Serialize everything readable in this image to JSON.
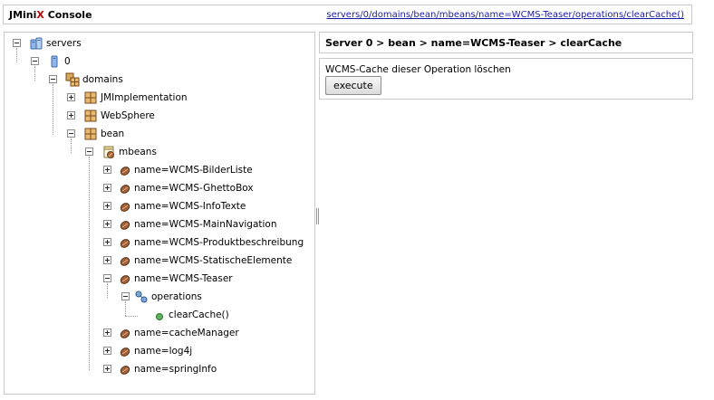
{
  "header": {
    "title_prefix": "JMini",
    "title_accent": "X",
    "title_suffix": " Console",
    "link": "servers/0/domains/bean/mbeans/name=WCMS-Teaser/operations/clearCache()"
  },
  "breadcrumb": "Server 0 > bean > name=WCMS-Teaser > clearCache",
  "operation": {
    "description": "WCMS-Cache dieser Operation löschen",
    "execute_label": "execute"
  },
  "tree": {
    "servers": "servers",
    "server0": "0",
    "domains": "domains",
    "domain_items": [
      "JMImplementation",
      "WebSphere",
      "bean"
    ],
    "mbeans": "mbeans",
    "mbean_items": [
      "name=WCMS-BilderListe",
      "name=WCMS-GhettoBox",
      "name=WCMS-InfoTexte",
      "name=WCMS-MainNavigation",
      "name=WCMS-Produktbeschreibung",
      "name=WCMS-StatischeElemente",
      "name=WCMS-Teaser",
      "name=cacheManager",
      "name=log4j",
      "name=springInfo"
    ],
    "operations": "operations",
    "clear_cache": "clearCache()"
  },
  "colors": {
    "accent": "#cc0000",
    "link": "#1a1aa8",
    "bean_icon": "#a0603a",
    "operation_dot": "#5bb35b",
    "border": "#c9c9c9"
  },
  "icons": [
    "servers-icon",
    "server-icon",
    "domains-icon",
    "domain-icon",
    "mbeans-icon",
    "mbean-icon",
    "operations-icon",
    "operation-icon"
  ]
}
